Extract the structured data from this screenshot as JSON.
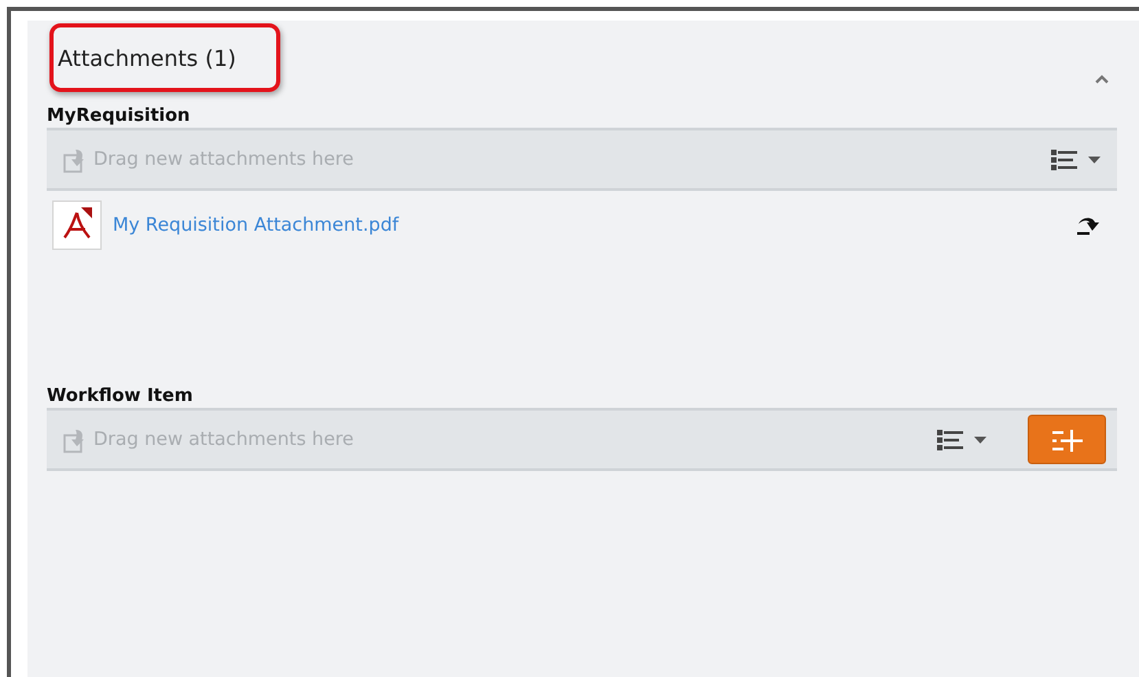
{
  "panel": {
    "title": "Attachments (1)",
    "highlighted": true,
    "sections": [
      {
        "label": "MyRequisition",
        "dropzone": "Drag new attachments here",
        "add_button": false,
        "files": [
          {
            "name": "My Requisition Attachment.pdf"
          }
        ]
      },
      {
        "label": "Workflow Item",
        "dropzone": "Drag new attachments here",
        "add_button": true
      }
    ]
  }
}
